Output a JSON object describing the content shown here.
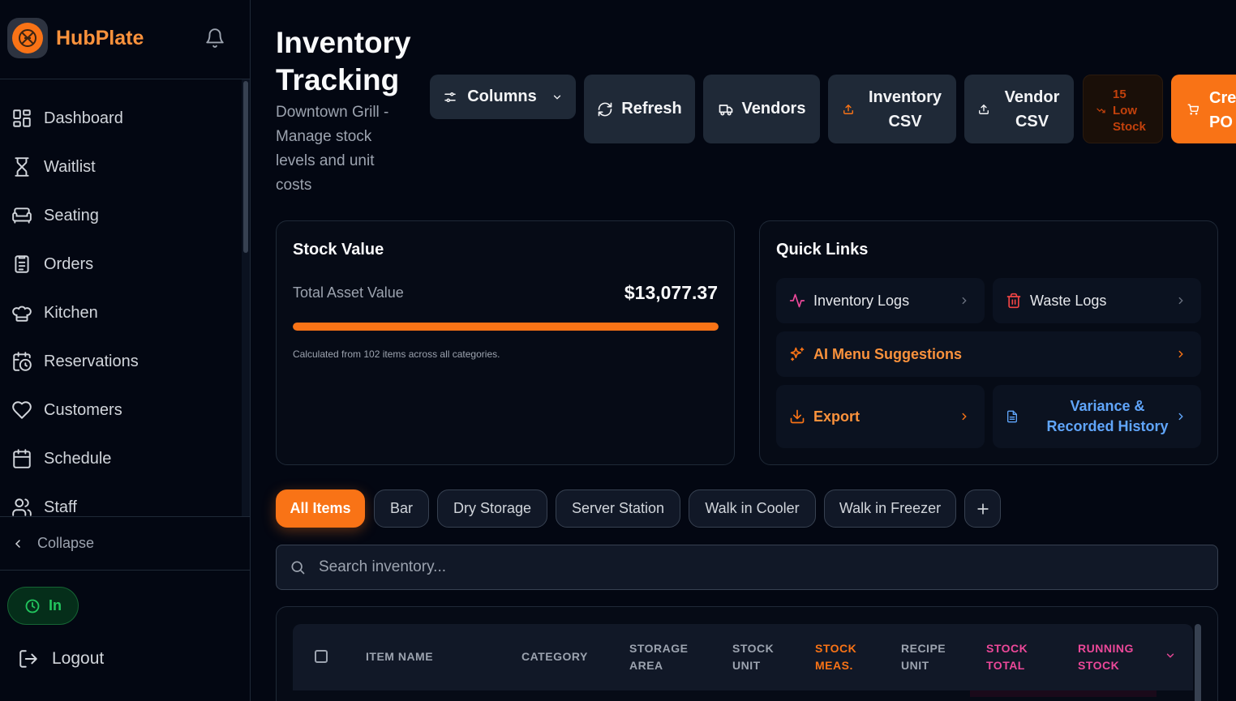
{
  "app": {
    "name": "HubPlate"
  },
  "sidebar": {
    "items": [
      {
        "label": "Dashboard",
        "icon": "dashboard-icon"
      },
      {
        "label": "Waitlist",
        "icon": "hourglass-icon"
      },
      {
        "label": "Seating",
        "icon": "sofa-icon"
      },
      {
        "label": "Orders",
        "icon": "clipboard-icon"
      },
      {
        "label": "Kitchen",
        "icon": "chef-hat-icon"
      },
      {
        "label": "Reservations",
        "icon": "calendar-clock-icon"
      },
      {
        "label": "Customers",
        "icon": "heart-icon"
      },
      {
        "label": "Schedule",
        "icon": "calendar-icon"
      },
      {
        "label": "Staff",
        "icon": "users-icon"
      }
    ],
    "collapse_label": "Collapse",
    "clock_label": "In",
    "logout_label": "Logout"
  },
  "header": {
    "title": "Inventory Tracking",
    "subtitle": "Downtown Grill - Manage stock levels and unit costs"
  },
  "toolbar": {
    "columns_label": "Columns",
    "refresh_label": "Refresh",
    "vendors_label": "Vendors",
    "inventory_csv_label": "Inventory CSV",
    "vendor_csv_label": "Vendor CSV",
    "low_stock_count": "15",
    "low_stock_label": "Low Stock",
    "create_po_label": "Create PO"
  },
  "stock_value": {
    "title": "Stock Value",
    "label": "Total Asset Value",
    "value": "$13,077.37",
    "fill_fraction": 1.0,
    "note": "Calculated from 102 items across all categories."
  },
  "quick_links": {
    "title": "Quick Links",
    "inventory_logs": "Inventory Logs",
    "waste_logs": "Waste Logs",
    "ai_menu": "AI Menu Suggestions",
    "export": "Export",
    "variance": "Variance & Recorded History"
  },
  "tabs": [
    "All Items",
    "Bar",
    "Dry Storage",
    "Server Station",
    "Walk in Cooler",
    "Walk in Freezer"
  ],
  "search": {
    "placeholder": "Search inventory..."
  },
  "table": {
    "columns": [
      "ITEM NAME",
      "CATEGORY",
      "STORAGE AREA",
      "STOCK UNIT",
      "STOCK MEAS.",
      "RECIPE UNIT",
      "STOCK TOTAL",
      "RUNNING STOCK"
    ]
  },
  "colors": {
    "accent": "#f97316",
    "background": "#030712",
    "card": "#060b16",
    "pink": "#ec4899",
    "blue": "#60a5fa",
    "green": "#22c55e"
  }
}
